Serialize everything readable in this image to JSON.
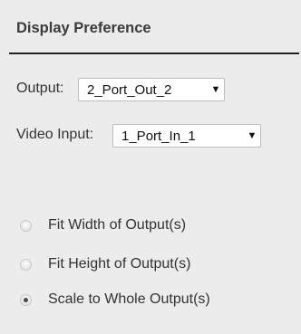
{
  "panel": {
    "title": "Display Preference",
    "output_label": "Output:",
    "output_value": "2_Port_Out_2",
    "video_input_label": "Video Input:",
    "video_input_value": "1_Port_In_1",
    "dropdown_arrow": "▼",
    "options": [
      {
        "label": "Fit Width of Output(s)",
        "selected": false
      },
      {
        "label": "Fit Height of Output(s)",
        "selected": false
      },
      {
        "label": "Scale to Whole Output(s)",
        "selected": true
      }
    ]
  }
}
